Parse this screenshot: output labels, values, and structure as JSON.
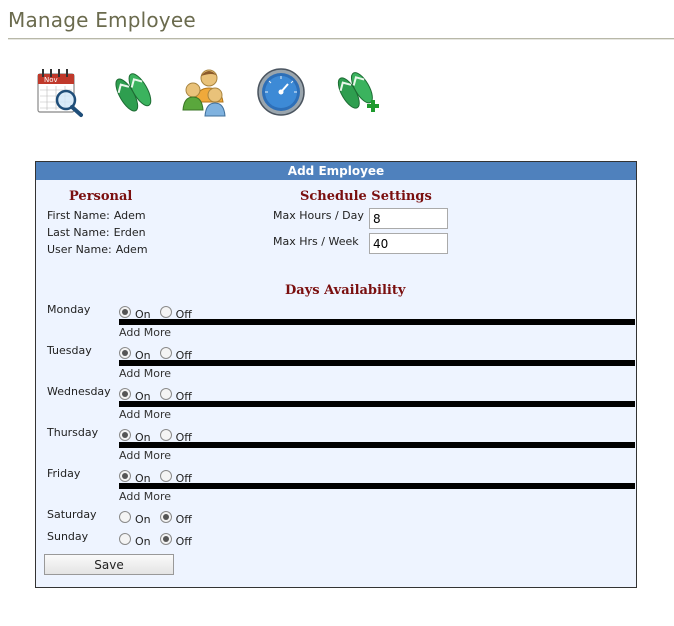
{
  "page": {
    "title": "Manage Employee"
  },
  "toolbar": {
    "icons": [
      "calendar-search-icon",
      "flip-flops-icon",
      "users-group-icon",
      "gauge-icon",
      "flip-flops-add-icon"
    ]
  },
  "panel": {
    "header": "Add Employee",
    "personal": {
      "title": "Personal",
      "first_name_label": "First Name:",
      "first_name": "Adem",
      "last_name_label": "Last Name:",
      "last_name": "Erden",
      "user_name_label": "User Name:",
      "user_name": "Adem"
    },
    "schedule": {
      "title": "Schedule Settings",
      "max_hours_day_label": "Max Hours / Day",
      "max_hours_day": "8",
      "max_hrs_week_label": "Max Hrs / Week",
      "max_hrs_week": "40"
    },
    "availability": {
      "title": "Days Availability",
      "on_label": "On",
      "off_label": "Off",
      "add_more_label": "Add More",
      "days": [
        {
          "name": "Monday",
          "status": "on"
        },
        {
          "name": "Tuesday",
          "status": "on"
        },
        {
          "name": "Wednesday",
          "status": "on"
        },
        {
          "name": "Thursday",
          "status": "on"
        },
        {
          "name": "Friday",
          "status": "on"
        },
        {
          "name": "Saturday",
          "status": "off"
        },
        {
          "name": "Sunday",
          "status": "off"
        }
      ]
    },
    "save_label": "Save"
  },
  "colors": {
    "header_bg": "#4f81bd",
    "panel_bg": "#eef4ff",
    "section_title": "#7a0f0f",
    "page_title": "#6b6b4e"
  }
}
